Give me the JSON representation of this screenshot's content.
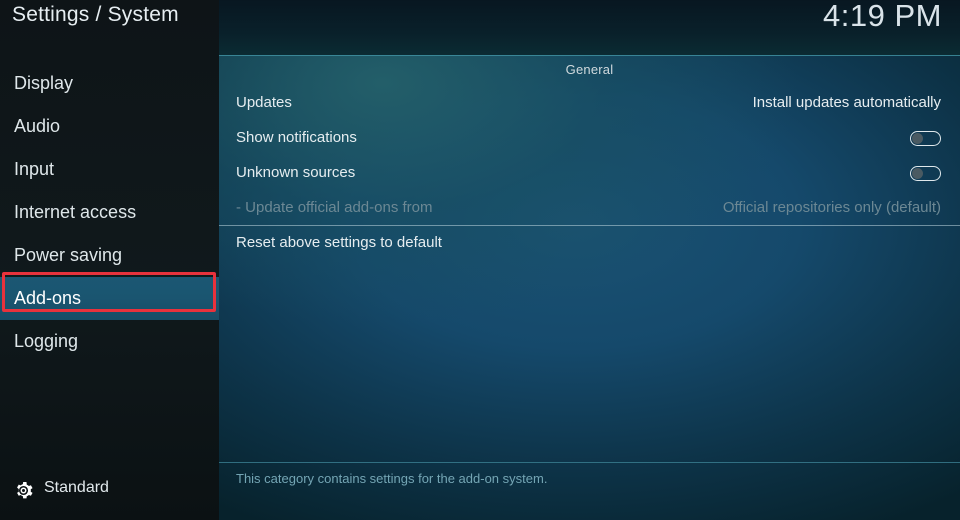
{
  "window": {
    "title": "Settings / System",
    "clock": "4:19 PM"
  },
  "sidebar": {
    "items": [
      {
        "label": "Display",
        "selected": false
      },
      {
        "label": "Audio",
        "selected": false
      },
      {
        "label": "Input",
        "selected": false
      },
      {
        "label": "Internet access",
        "selected": false
      },
      {
        "label": "Power saving",
        "selected": false
      },
      {
        "label": "Add-ons",
        "selected": true
      },
      {
        "label": "Logging",
        "selected": false
      }
    ],
    "footer": {
      "icon": "gear-icon",
      "label": "Standard"
    }
  },
  "main": {
    "section_header": "General",
    "rows": [
      {
        "label": "Updates",
        "value": "Install updates automatically",
        "control": "text",
        "disabled": false
      },
      {
        "label": "Show notifications",
        "value": "",
        "control": "toggle",
        "toggle_on": false,
        "disabled": false
      },
      {
        "label": "Unknown sources",
        "value": "",
        "control": "toggle",
        "toggle_on": false,
        "disabled": false
      },
      {
        "label": "- Update official add-ons from",
        "value": "Official repositories only (default)",
        "control": "text",
        "disabled": true
      },
      {
        "label": "Reset above settings to default",
        "value": "",
        "control": "none",
        "disabled": false
      }
    ],
    "description": "This category contains settings for the add-on system."
  },
  "annotation": {
    "type": "highlight-rectangle",
    "color": "#e8323c",
    "target": "sidebar-item-add-ons"
  },
  "colors": {
    "accent_teal": "#3f8fa0",
    "selected_row": "#1a5570",
    "annotation_red": "#e8323c",
    "disabled_text": "#6c8894",
    "description_text": "#74a5b4"
  }
}
